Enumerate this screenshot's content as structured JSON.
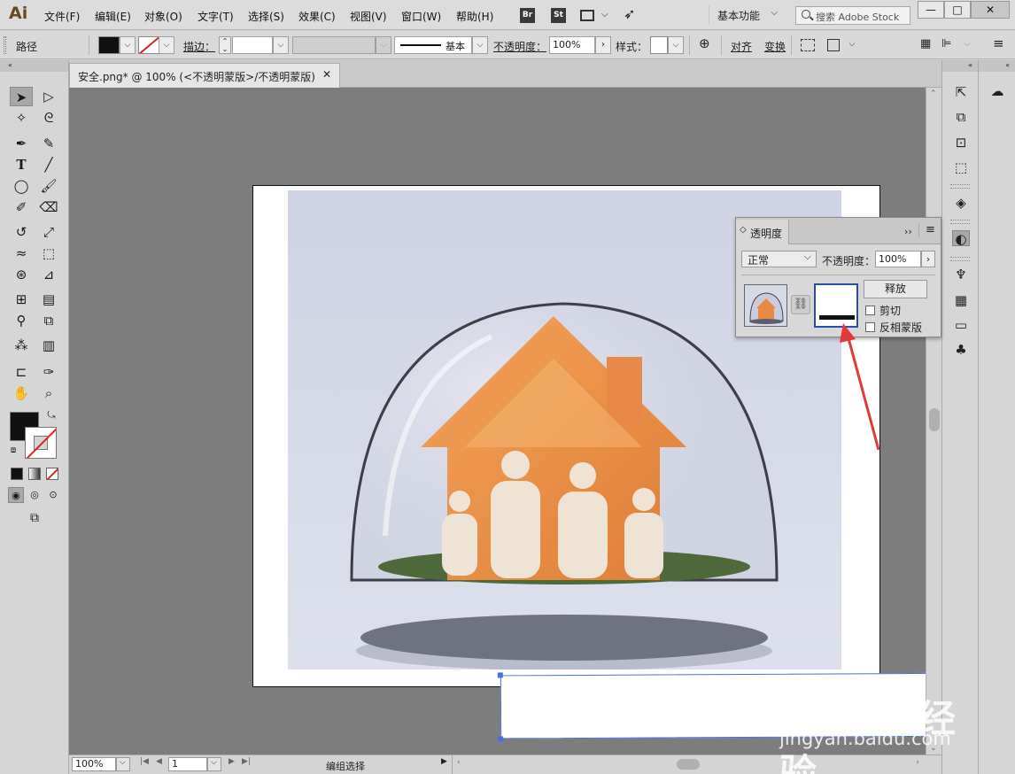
{
  "app": {
    "logo": "Ai"
  },
  "menu": {
    "items": [
      "文件(F)",
      "编辑(E)",
      "对象(O)",
      "文字(T)",
      "选择(S)",
      "效果(C)",
      "视图(V)",
      "窗口(W)",
      "帮助(H)"
    ],
    "bridge": "Br",
    "stock_app": "St",
    "workspace": "基本功能",
    "search_placeholder": "搜索 Adobe Stock",
    "win_min": "—",
    "win_max": "□",
    "win_close": "✕"
  },
  "control": {
    "object_type": "路径",
    "stroke_label": "描边：",
    "stroke_style": "基本",
    "opacity_label": "不透明度：",
    "opacity_value": "100%",
    "style_label": "样式：",
    "align_label": "对齐",
    "transform_label": "变换"
  },
  "document": {
    "tab_title": "安全.png* @ 100% (<不透明蒙版>/不透明蒙版)",
    "tab_close": "✕"
  },
  "status": {
    "zoom": "100%",
    "artboard": "1",
    "tool": "编组选择"
  },
  "transparency_panel": {
    "title": "透明度",
    "blend_mode": "正常",
    "opacity_label": "不透明度：",
    "opacity_value": "100%",
    "release_label": "释放",
    "clip_label": "剪切",
    "invert_label": "反相蒙版",
    "clip_checked": false,
    "invert_checked": false
  },
  "watermark": {
    "logo": "Bai du 经验",
    "url": "jingyan.baidu.com"
  },
  "colors": {
    "accent": "#4a6ee0",
    "arrow": "#e23a3a",
    "canvas": "#7d7d7d"
  }
}
